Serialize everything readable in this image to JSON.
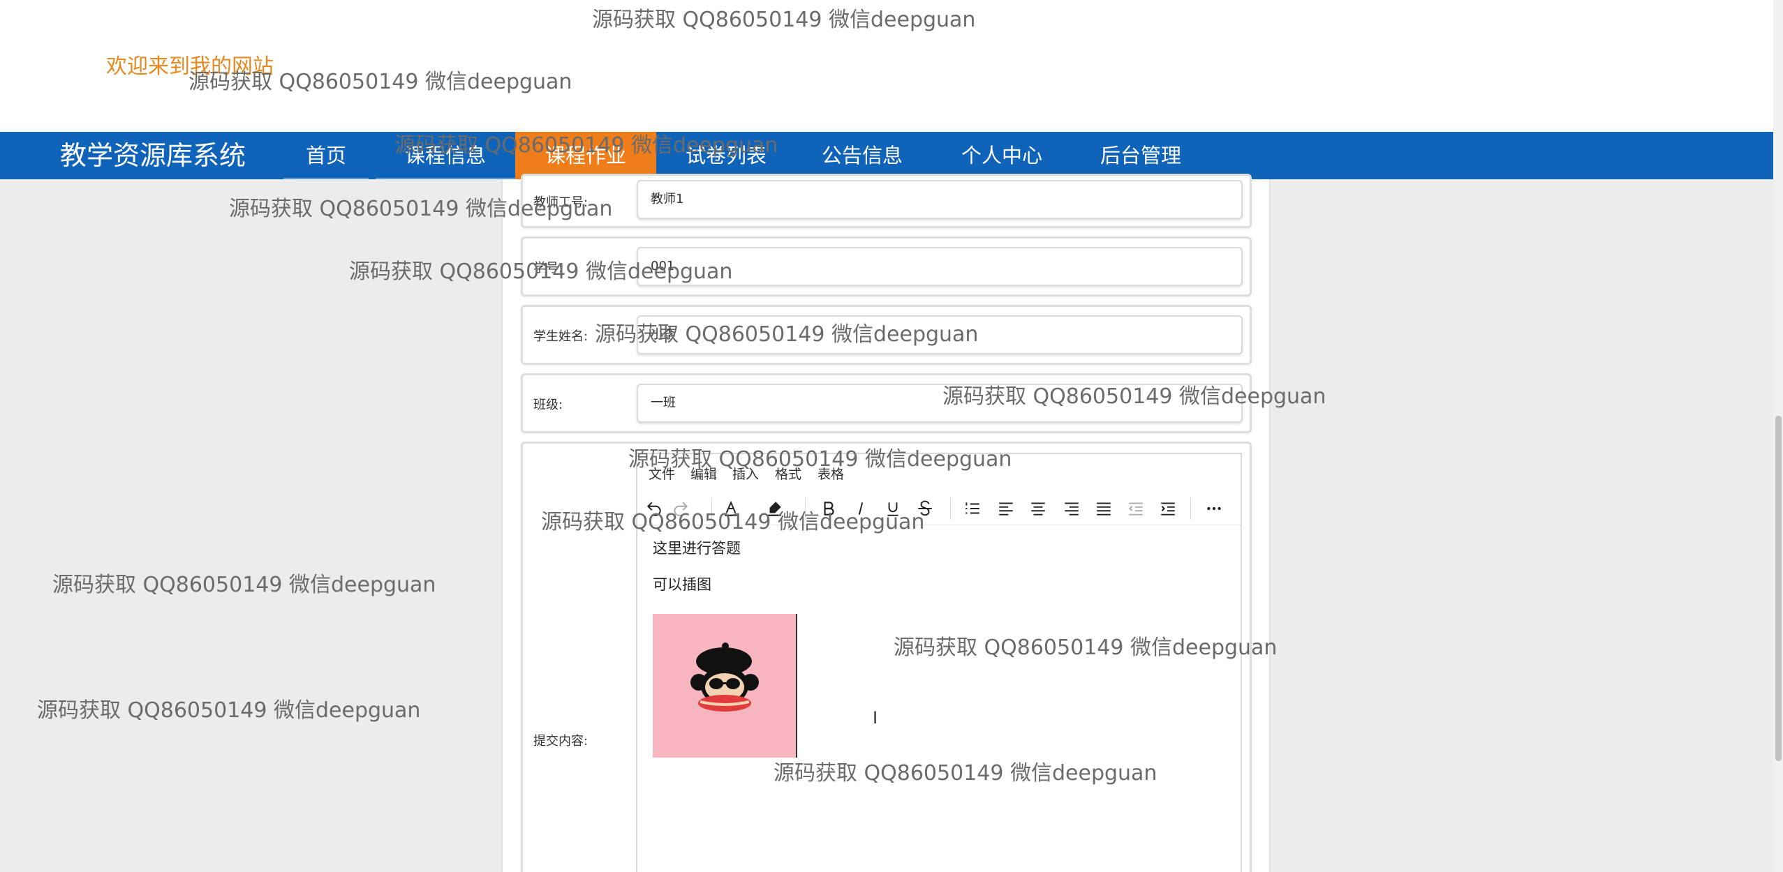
{
  "header": {
    "welcome": "欢迎来到我的网站"
  },
  "nav": {
    "brand": "教学资源库系统",
    "items": [
      {
        "label": "首页",
        "active": false
      },
      {
        "label": "课程信息",
        "active": false
      },
      {
        "label": "课程作业",
        "active": true
      },
      {
        "label": "试卷列表",
        "active": false
      },
      {
        "label": "公告信息",
        "active": false
      },
      {
        "label": "个人中心",
        "active": false
      },
      {
        "label": "后台管理",
        "active": false
      }
    ]
  },
  "form": {
    "fields": [
      {
        "label": "教师工号:",
        "value": "教师1"
      },
      {
        "label": "学号:",
        "value": "001"
      },
      {
        "label": "学生姓名:",
        "value": "小李"
      },
      {
        "label": "班级:",
        "value": "一班"
      }
    ],
    "submit_label": "提交内容:"
  },
  "editor": {
    "menus": [
      "文件",
      "编辑",
      "插入",
      "格式",
      "表格"
    ],
    "toolbar": [
      "undo-icon",
      "redo-icon",
      "text-color-icon",
      "highlight-icon",
      "bold-icon",
      "italic-icon",
      "underline-icon",
      "strikethrough-icon",
      "numbered-list-icon",
      "align-left-icon",
      "align-center-icon",
      "align-right-icon",
      "align-justify-icon",
      "outdent-icon",
      "indent-icon",
      "more-icon"
    ],
    "content": {
      "line1": "这里进行答题",
      "line2": "可以插图"
    }
  },
  "watermark": {
    "text": "源码获取 QQ86050149 微信deepguan"
  },
  "colors": {
    "nav_bg": "#0f63b8",
    "nav_active": "#ef7d1a",
    "welcome": "#e8891f"
  }
}
